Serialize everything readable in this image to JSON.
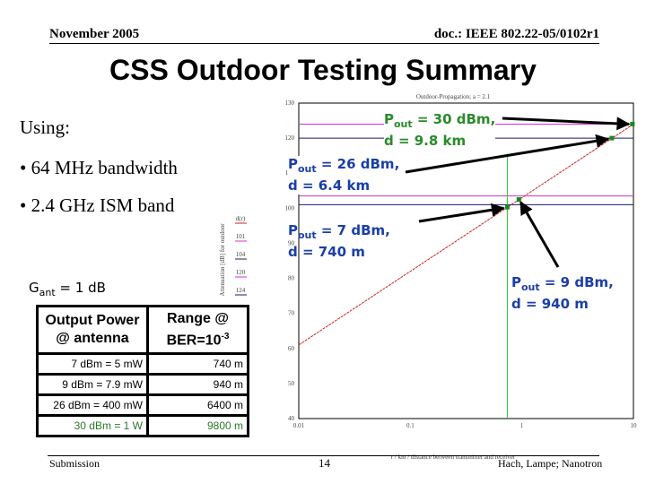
{
  "header": {
    "date": "November 2005",
    "doc": "doc.: IEEE 802.22-05/0102r1"
  },
  "title": "CSS Outdoor Testing Summary",
  "using": "Using:",
  "bullets": [
    "• 64 MHz bandwidth",
    "• 2.4 GHz ISM band"
  ],
  "gant": {
    "g": "G",
    "sub": "ant",
    "rest": " = 1 dB"
  },
  "table": {
    "headers": [
      {
        "l1": "Output Power",
        "l2": "@ antenna"
      },
      {
        "l1": "Range @",
        "l2": "BER=10",
        "sup": "-3"
      }
    ],
    "rows": [
      {
        "power": "7 dBm =    5 mW",
        "range": "740 m"
      },
      {
        "power": "9 dBm = 7.9 mW",
        "range": "940 m"
      },
      {
        "power": "26 dBm = 400 mW",
        "range": "6400 m"
      },
      {
        "power": "30 dBm =  1   W",
        "range": "9800 m",
        "highlight": true
      }
    ]
  },
  "callouts": [
    {
      "p": "P",
      "sub": "out",
      "val": " = 30 dBm,",
      "d": "d = 9.8 km",
      "color": "#2a8a2a"
    },
    {
      "p": "P",
      "sub": "out",
      "val": " = 26 dBm,",
      "d": "d = 6.4 km",
      "color": "#1a3fa8"
    },
    {
      "p": "P",
      "sub": "out",
      "val": " = 7 dBm,",
      "d": "d = 740 m",
      "color": "#1a3fa8"
    },
    {
      "p": "P",
      "sub": "out",
      "val": " = 9 dBm,",
      "d": "d = 940 m",
      "color": "#1a3fa8"
    }
  ],
  "chart_data": {
    "type": "line",
    "title": "Outdoor-Propagation; a = 2.1",
    "ylabel": "Attenuation [dB] for outdoor",
    "xlabel": "r / km / distance between transmitter and receiver",
    "xscale": "log",
    "xlim": [
      0.01,
      10
    ],
    "ylim": [
      40,
      130
    ],
    "xticks": [
      "0.01",
      "0.1",
      "1",
      "10"
    ],
    "yticks": [
      "130",
      "120",
      "110",
      "100",
      "90",
      "80",
      "70",
      "60",
      "50",
      "40"
    ],
    "series": [
      {
        "name": "d(r)",
        "x": [
          0.01,
          10
        ],
        "y": [
          61,
          124
        ],
        "color": "#cc2222"
      }
    ],
    "hlines": [
      {
        "y": 124,
        "color": "#cc33cc"
      },
      {
        "y": 120,
        "color": "#1a1a6a"
      },
      {
        "y": 103.5,
        "color": "#cc33cc"
      },
      {
        "y": 101,
        "color": "#1a1a6a"
      }
    ],
    "vline": {
      "x": 0.74,
      "color": "#33bb33"
    },
    "legend": [
      "d(r)",
      "101",
      "104",
      "120",
      "124"
    ],
    "points": [
      {
        "x": 0.74,
        "y": 100.3
      },
      {
        "x": 0.94,
        "y": 102.5
      },
      {
        "x": 6.4,
        "y": 120
      },
      {
        "x": 9.8,
        "y": 124
      }
    ],
    "point_color": "#1a8a1a",
    "grid": false
  },
  "footer": {
    "left": "Submission",
    "page": "14",
    "right": "Hach, Lampe; Nanotron"
  }
}
